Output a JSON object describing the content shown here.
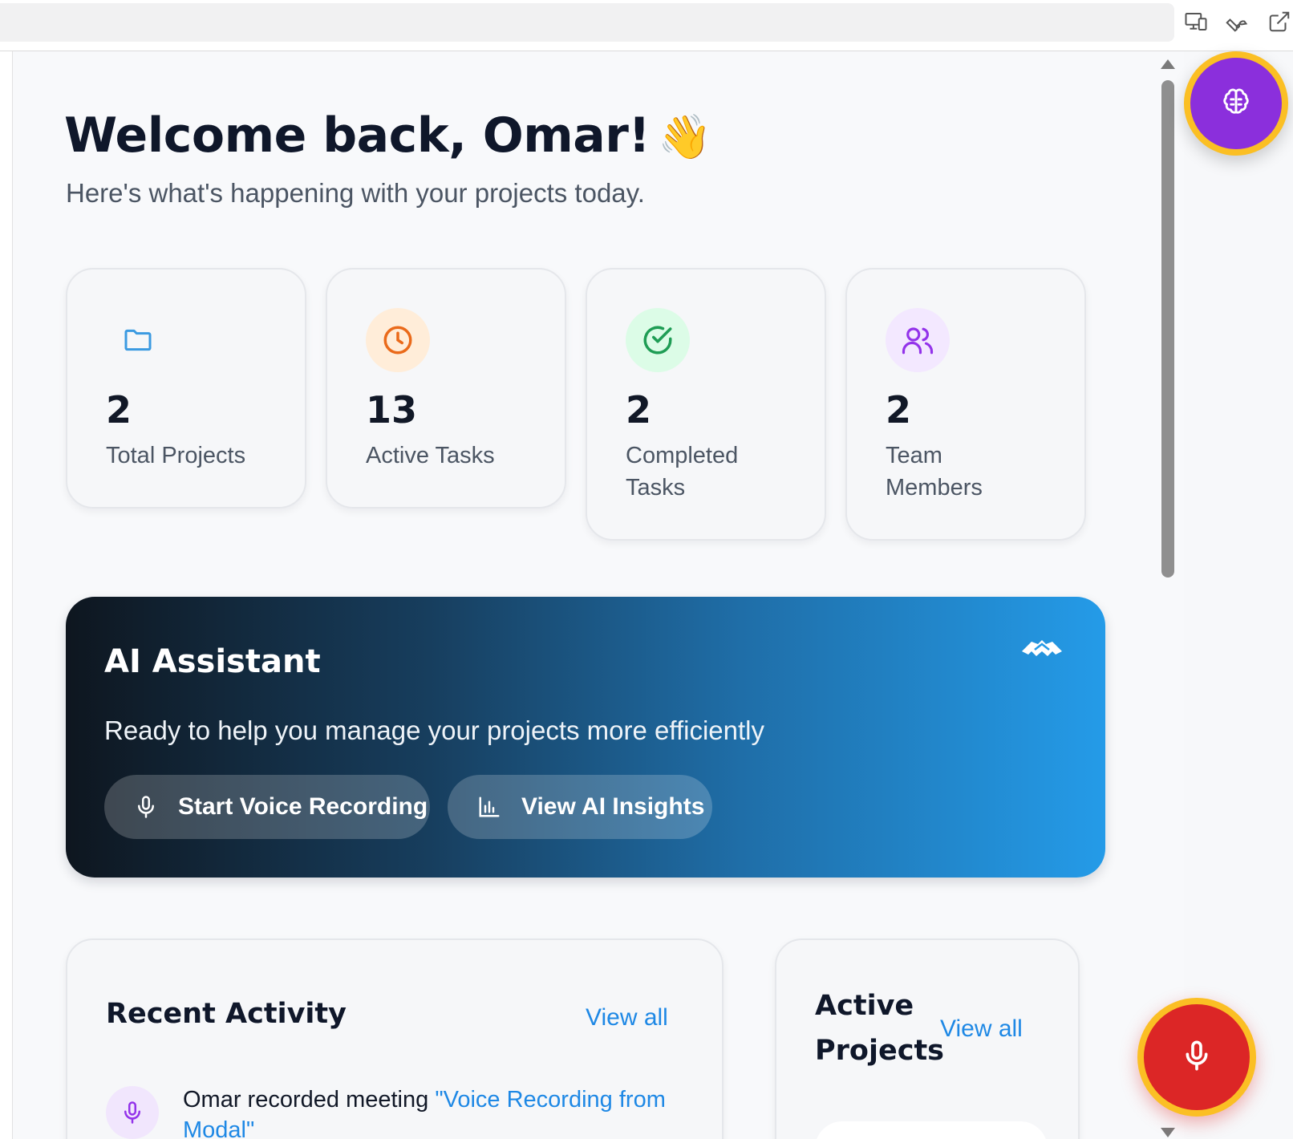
{
  "header": {
    "greeting": "Welcome back, Omar!",
    "wave_emoji": "👋",
    "subtitle": "Here's what's happening with your projects today."
  },
  "stats": [
    {
      "value": "2",
      "label": "Total Projects",
      "icon": "folder-icon",
      "icon_color": "#3b9ae1",
      "icon_bg": "transparent"
    },
    {
      "value": "13",
      "label": "Active Tasks",
      "icon": "clock-icon",
      "icon_color": "#ea6a1a",
      "icon_bg": "#ffedd9"
    },
    {
      "value": "2",
      "label": "Completed Tasks",
      "icon": "check-circle-icon",
      "icon_color": "#1f9d55",
      "icon_bg": "#dcfce7"
    },
    {
      "value": "2",
      "label": "Team Members",
      "icon": "users-icon",
      "icon_color": "#9333ea",
      "icon_bg": "#f3e8ff"
    }
  ],
  "ai_assistant": {
    "title": "AI Assistant",
    "subtitle": "Ready to help you manage your projects more efficiently",
    "record_button": "Start Voice Recording",
    "insights_button": "View AI Insights",
    "icon": "handshake-icon"
  },
  "recent_activity": {
    "title": "Recent Activity",
    "view_all": "View all",
    "items": [
      {
        "prefix": "Omar recorded meeting ",
        "highlight": "\"Voice Recording from Modal\"",
        "icon": "mic-icon"
      }
    ]
  },
  "active_projects": {
    "title": "Active Projects",
    "view_all": "View all"
  },
  "colors": {
    "accent_blue": "#1e88e5",
    "fab_purple": "#8b2fdc",
    "fab_red": "#dc2626",
    "ring_yellow": "#fbbf24"
  }
}
